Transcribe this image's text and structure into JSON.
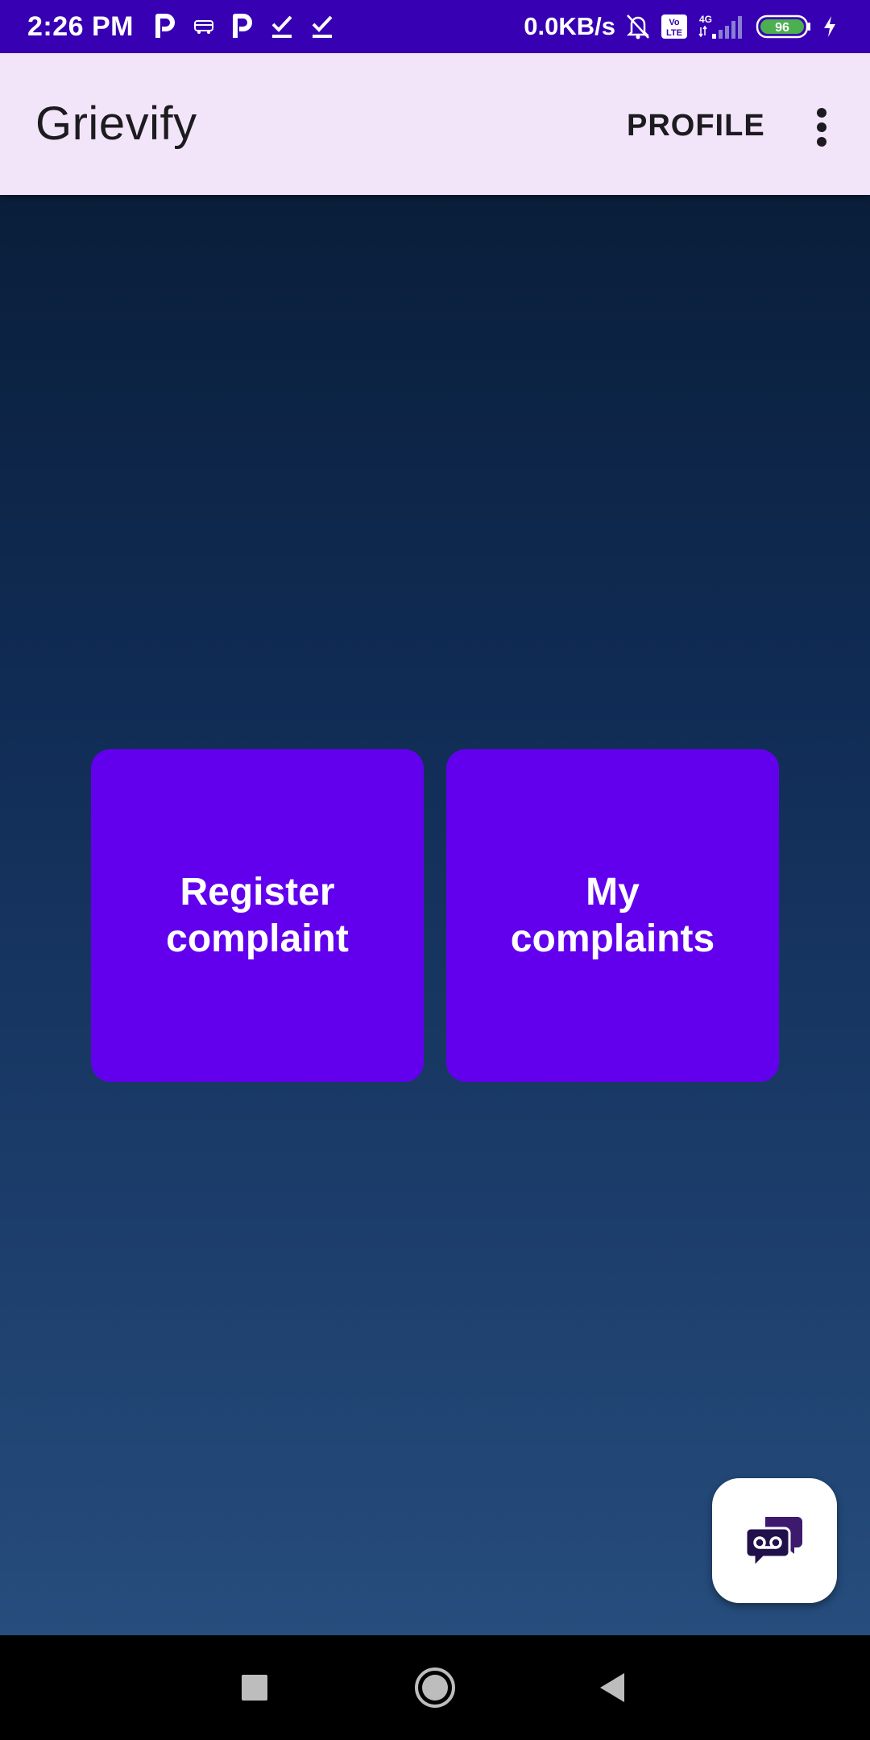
{
  "status_bar": {
    "time": "2:26 PM",
    "net_speed": "0.0KB/s",
    "network_type": "4G",
    "volte_label": "Vo LTE",
    "battery_level": "96",
    "icons": [
      "parking-icon",
      "bus-icon",
      "parking-icon",
      "check-icon",
      "check-icon",
      "bell-off-icon",
      "volte-icon",
      "signal-icon",
      "battery-icon",
      "charging-icon"
    ],
    "bg_color": "#3700B3"
  },
  "app_bar": {
    "title": "Grievify",
    "profile_label": "PROFILE",
    "overflow_icon": "more-vertical-icon",
    "bg_color": "#F3E5F9"
  },
  "main": {
    "tiles": [
      {
        "label": "Register\ncomplaint"
      },
      {
        "label": "My\ncomplaints"
      }
    ],
    "tile_color": "#6200EE",
    "fab_icon": "chat-voicemail-icon"
  },
  "nav_bar": {
    "buttons": [
      "recents-icon",
      "home-icon",
      "back-icon"
    ]
  }
}
